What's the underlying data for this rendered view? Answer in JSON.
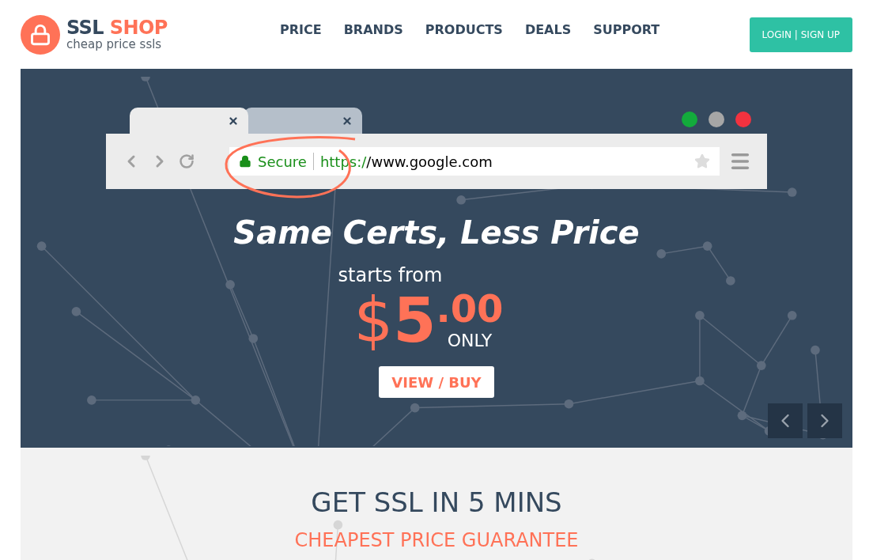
{
  "header": {
    "logo": {
      "brand_dark": "SSL",
      "brand_accent": "SHOP",
      "tagline": "cheap price ssls"
    },
    "nav": [
      "PRICE",
      "BRANDS",
      "PRODUCTS",
      "DEALS",
      "SUPPORT"
    ],
    "login": "LOGIN | SIGN UP"
  },
  "banner": {
    "browser": {
      "tabs": [
        {
          "selected": true
        },
        {
          "selected": false
        }
      ],
      "window_dots": [
        {
          "color": "#13ab3c"
        },
        {
          "color": "#a6a6a6"
        },
        {
          "color": "#f2323f"
        }
      ],
      "secure_label": "Secure",
      "url_scheme": "https:/",
      "url_rest": "/www.google.com"
    },
    "headline": "Same Certs, Less Price",
    "starts": "starts from",
    "currency": "$",
    "whole": "5",
    "cents": ".00",
    "only": "ONLY",
    "cta": "VIEW / BUY"
  },
  "section": {
    "title": "GET SSL IN 5 MINS",
    "subtitle": "CHEAPEST PRICE GUARANTEE"
  }
}
